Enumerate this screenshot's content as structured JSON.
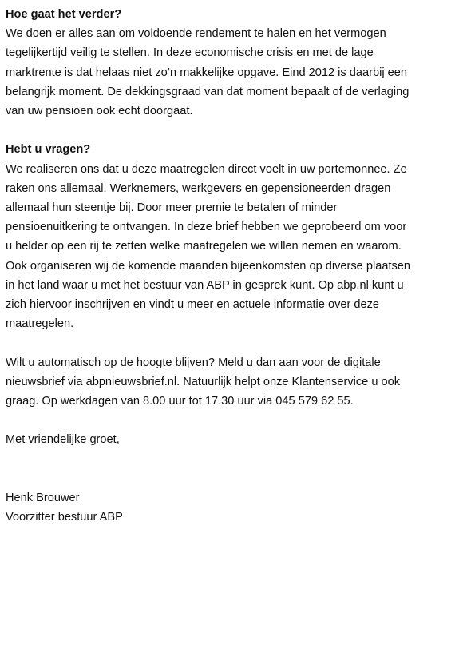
{
  "section1": {
    "heading": "Hoe gaat het verder?",
    "lines": [
      "We doen er alles aan om voldoende  rendement te halen en het vermogen",
      "tegelijkertijd veilig te stellen.  In deze economische crisis en met de lage",
      "marktrente is dat helaas niet zo’n makkelijke opgave. Eind 2012 is daarbij een",
      "belangrijk moment. De dekkingsgraad van dat moment bepaalt of de verlaging",
      "van uw pensioen ook echt doorgaat."
    ]
  },
  "section2": {
    "heading": "Hebt u vragen?",
    "lines": [
      "We realiseren ons dat u deze maatregelen direct voelt in uw portemonnee. Ze",
      "raken ons allemaal.  Werknemers, werkgevers en gepensioneerden dragen",
      "allemaal hun steentje bij. Door meer premie te betalen of minder",
      "pensioenuitkering te ontvangen. In deze brief hebben we geprobeerd om voor",
      "u helder op een rij te zetten welke maatregelen we willen nemen en waarom.",
      "Ook organiseren wij de komende maanden bijeenkomsten op diverse plaatsen",
      "in het land waar u met het bestuur van ABP in gesprek kunt. Op abp.nl  kunt u",
      "zich hiervoor inschrijven en vindt u meer en actuele informatie over deze",
      "maatregelen."
    ]
  },
  "section3": {
    "lines": [
      "Wilt u automatisch op de hoogte blijven? Meld u dan aan voor de digitale",
      "nieuwsbrief via abpnieuwsbrief.nl.  Natuurlijk helpt onze Klantenservice u ook",
      "graag. Op werkdagen van 8.00 uur tot 17.30 uur via 045 579 62 55."
    ]
  },
  "closing": {
    "greeting": "Met vriendelijke groet,",
    "name": "Henk Brouwer",
    "title": "Voorzitter bestuur ABP"
  }
}
